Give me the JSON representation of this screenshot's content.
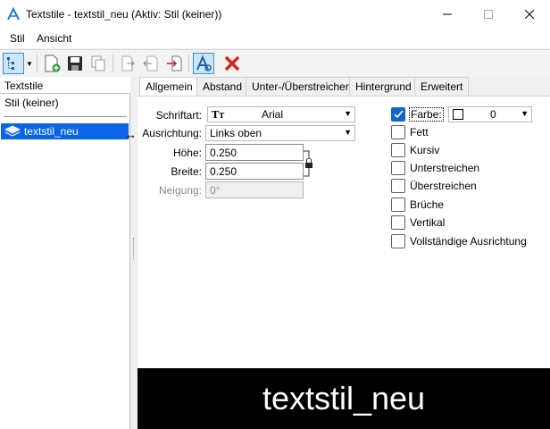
{
  "window": {
    "title": "Textstile - textstil_neu (Aktiv: Stil (keiner))"
  },
  "menu": {
    "stil": "Stil",
    "ansicht": "Ansicht"
  },
  "left": {
    "header": "Textstile",
    "none_item": "Stil (keiner)",
    "selected_item": "textstil_neu"
  },
  "tabs": [
    "Allgemein",
    "Abstand",
    "Unter-/Überstreichen",
    "Hintergrund",
    "Erweitert"
  ],
  "form": {
    "schriftart_label": "Schriftart:",
    "schriftart_value": "Arial",
    "ausrichtung_label": "Ausrichtung:",
    "ausrichtung_value": "Links oben",
    "hoehe_label": "Höhe:",
    "hoehe_value": "0.250",
    "breite_label": "Breite:",
    "breite_value": "0.250",
    "neigung_label": "Neigung:",
    "neigung_value": "0°"
  },
  "options": {
    "farbe_label": "Farbe:",
    "farbe_value": "0",
    "farbe_checked": true,
    "fett": "Fett",
    "kursiv": "Kursiv",
    "unterstreichen": "Unterstreichen",
    "ueberstreichen": "Überstreichen",
    "brueche": "Brüche",
    "vertikal": "Vertikal",
    "vollstaendige": "Vollständige Ausrichtung"
  },
  "preview": {
    "text": "textstil_neu"
  },
  "colors": {
    "selection": "#0a64e8",
    "check": "#1166cc",
    "delete": "#d9261c"
  }
}
